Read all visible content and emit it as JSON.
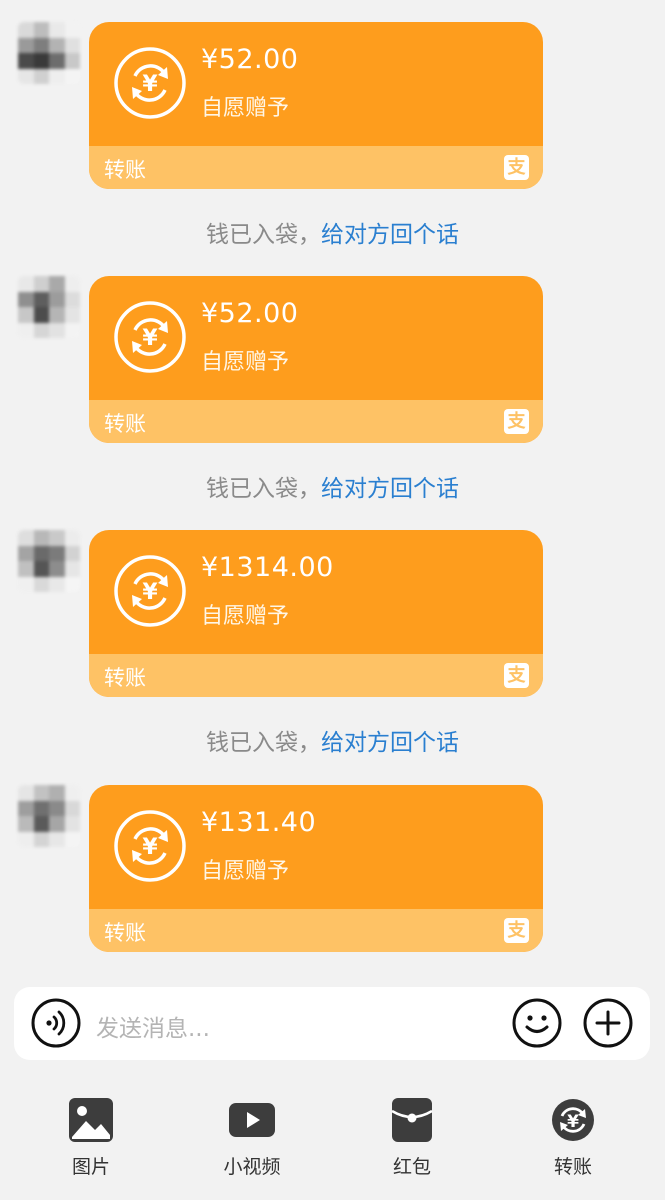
{
  "messages": [
    {
      "amount": "¥52.00",
      "memo": "自愿赠予",
      "footer_label": "转账",
      "notice_prefix": "钱已入袋，",
      "notice_link": "给对方回个话"
    },
    {
      "amount": "¥52.00",
      "memo": "自愿赠予",
      "footer_label": "转账",
      "notice_prefix": "钱已入袋，",
      "notice_link": "给对方回个话"
    },
    {
      "amount": "¥1314.00",
      "memo": "自愿赠予",
      "footer_label": "转账",
      "notice_prefix": "钱已入袋，",
      "notice_link": "给对方回个话"
    },
    {
      "amount": "¥131.40",
      "memo": "自愿赠予",
      "footer_label": "转账"
    }
  ],
  "alipay_glyph": "支",
  "input": {
    "placeholder": "发送消息..."
  },
  "toolbar": {
    "items": [
      {
        "label": "图片",
        "icon": "image-icon"
      },
      {
        "label": "小视频",
        "icon": "video-icon"
      },
      {
        "label": "红包",
        "icon": "red-packet-icon"
      },
      {
        "label": "转账",
        "icon": "transfer-icon"
      }
    ]
  },
  "colors": {
    "card": "#fe9d1d",
    "card_footer": "#fec265",
    "link": "#2a7fd0",
    "notice": "#8a8a8a",
    "background": "#f2f2f2"
  }
}
